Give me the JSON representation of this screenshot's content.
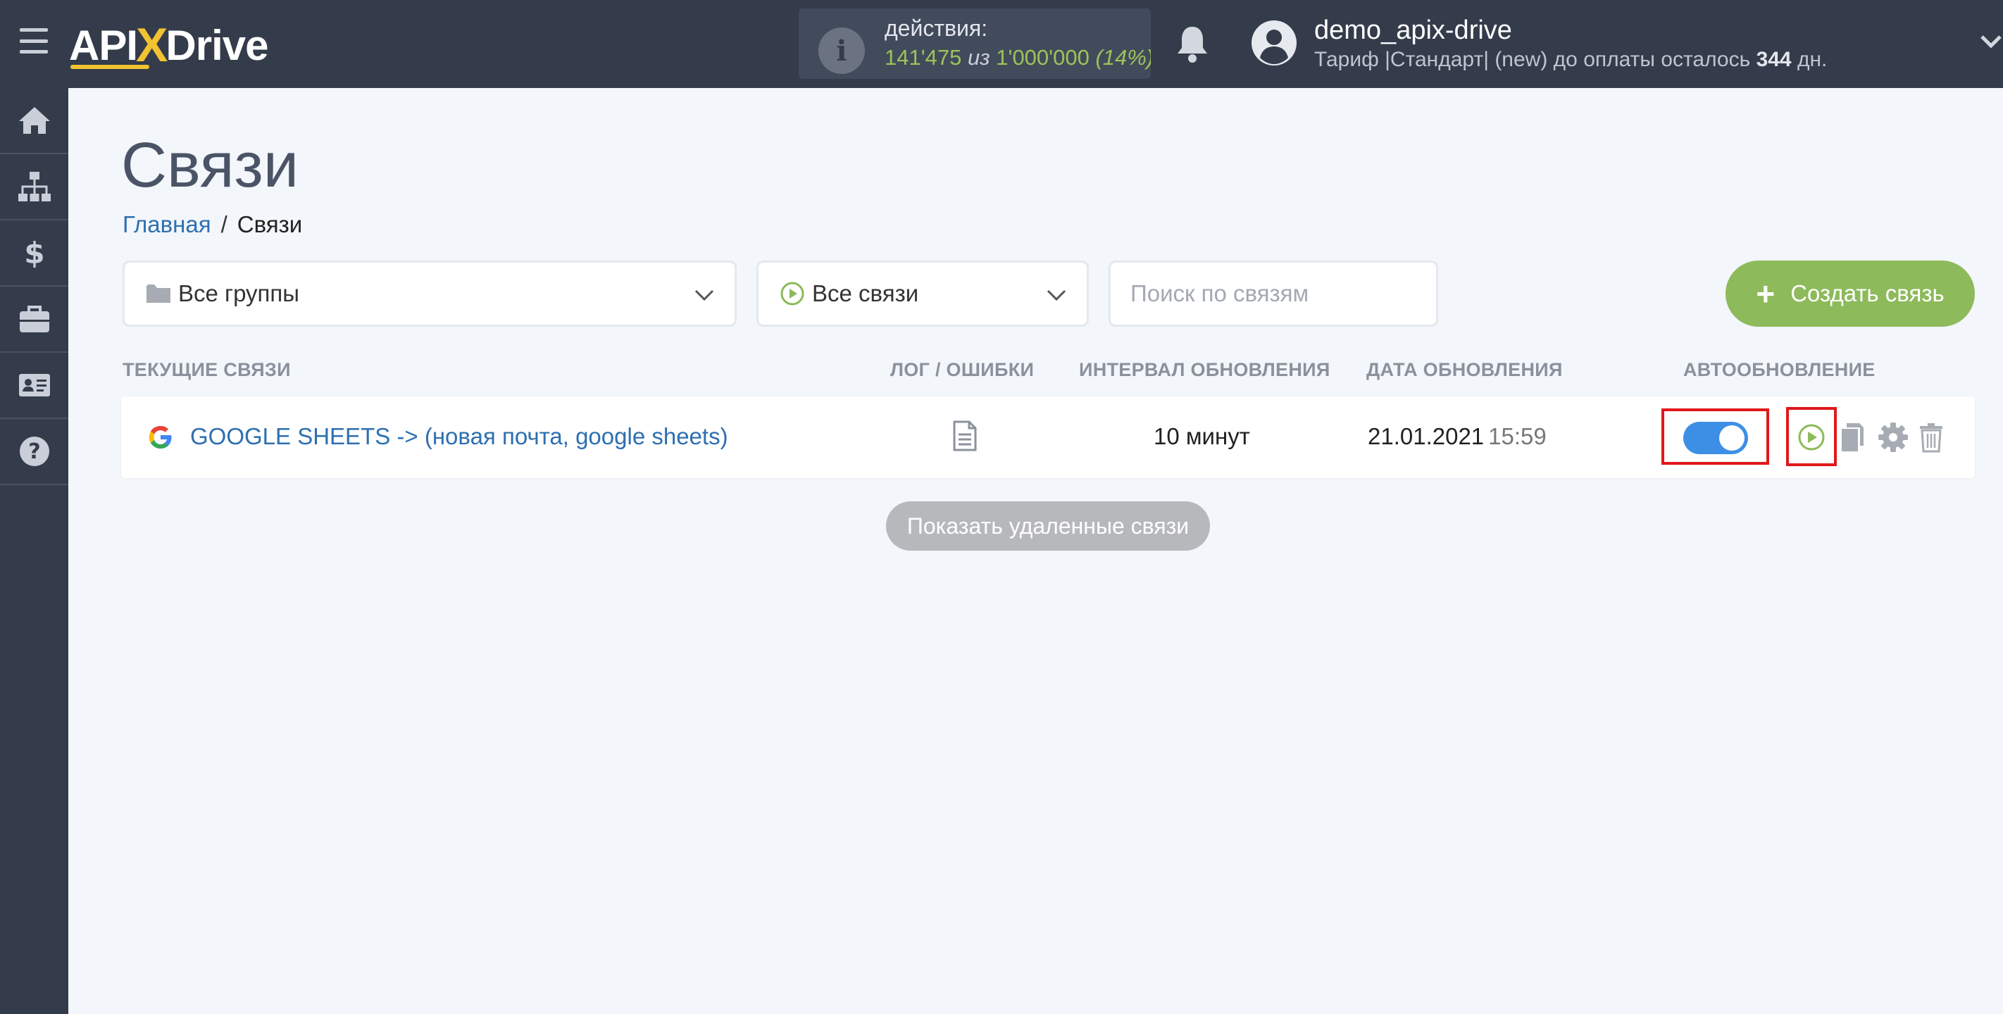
{
  "header": {
    "logo": {
      "part1": "API",
      "part2": "X",
      "part3": "Drive"
    },
    "actions": {
      "label": "действия:",
      "used": "141'475",
      "of": "из",
      "total": "1'000'000",
      "percent": "(14%)"
    },
    "user": {
      "name": "demo_apix-drive",
      "tariff_prefix": "Тариф |Стандарт| (new) до оплаты осталось",
      "days": "344",
      "days_suffix": "дн."
    }
  },
  "sidebar": {
    "items": [
      {
        "icon": "home-icon"
      },
      {
        "icon": "sitemap-icon"
      },
      {
        "icon": "dollar-icon"
      },
      {
        "icon": "briefcase-icon"
      },
      {
        "icon": "id-card-icon"
      },
      {
        "icon": "question-icon"
      }
    ]
  },
  "page": {
    "title": "Связи",
    "breadcrumb": {
      "home": "Главная",
      "separator": "/",
      "current": "Связи"
    }
  },
  "filters": {
    "groups_selected": "Все группы",
    "links_selected": "Все связи",
    "search_placeholder": "Поиск по связям",
    "create_label": "Создать связь",
    "create_plus": "+"
  },
  "table": {
    "headers": {
      "current": "ТЕКУЩИЕ СВЯЗИ",
      "log": "ЛОГ / ОШИБКИ",
      "interval": "ИНТЕРВАЛ ОБНОВЛЕНИЯ",
      "date": "ДАТА ОБНОВЛЕНИЯ",
      "auto": "АВТООБНОВЛЕНИЕ"
    },
    "rows": [
      {
        "name": "GOOGLE SHEETS -> (новая почта, google sheets)",
        "interval": "10 минут",
        "date": "21.01.2021",
        "time": "15:59",
        "autoupdate": true
      }
    ],
    "show_deleted": "Показать удаленные связи"
  },
  "colors": {
    "topbar": "#343c4b",
    "accent_green": "#8dba5a",
    "link_blue": "#2e6fb0",
    "toggle_blue": "#3d8fe6",
    "highlight_red": "#e0181b"
  }
}
